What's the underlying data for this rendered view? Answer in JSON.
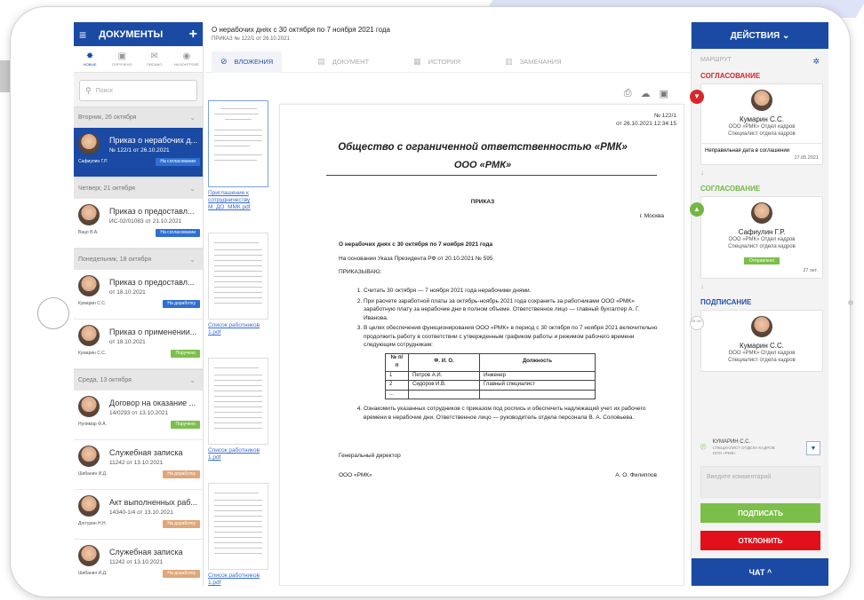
{
  "left": {
    "title": "ДОКУМЕНТЫ",
    "menu_icon": "hamburger-icon",
    "add": "+",
    "tabs": [
      {
        "label": "НОВЫЕ",
        "icon": "sun-icon"
      },
      {
        "label": "ПОРУЧЕНО",
        "icon": "folder-icon"
      },
      {
        "label": "ПИСЬМО",
        "icon": "mail-icon"
      },
      {
        "label": "НА КОНТРОЛЕ",
        "icon": "eye-icon"
      }
    ],
    "search_placeholder": "Поиск",
    "groups": [
      {
        "label": "Вторник, 26 октября",
        "items": [
          {
            "title": "Приказ о нерабочих д...",
            "sub": "№ 122/1 от 26.10.2021",
            "author": "Сафиулин Г.Р.",
            "badge": "На согласовании",
            "badge_color": "blue",
            "selected": true
          }
        ]
      },
      {
        "label": "Четверг, 21 октября",
        "items": [
          {
            "title": "Приказ о предоставл...",
            "sub": "ИС-02/01083 от 21.10.2021",
            "author": "Вацо В.А.",
            "badge": "На согласовании",
            "badge_color": "blue"
          }
        ]
      },
      {
        "label": "Понедельник, 18 октября",
        "items": [
          {
            "title": "Приказ о предоставл...",
            "sub": "от 18.10.2021",
            "author": "Кумарин С.С.",
            "badge": "На доработку",
            "badge_color": "blue"
          },
          {
            "title": "Приказ о применении...",
            "sub": "от 18.10.2021",
            "author": "Кумарин С.С.",
            "badge": "Поручено",
            "badge_color": "green"
          }
        ]
      },
      {
        "label": "Среда, 13 октября",
        "items": [
          {
            "title": "Договор на оказание ...",
            "sub": "14/0293 от 13.10.2021",
            "author": "Нулимар Ф.А.",
            "badge": "Поручено",
            "badge_color": "green"
          },
          {
            "title": "Служебная записка",
            "sub": "11242 от 13.10.2021",
            "author": "Шибанин И.Д.",
            "badge": "На доработку",
            "badge_color": "orange"
          },
          {
            "title": "Акт выполненных раб...",
            "sub": "14340-1/4 от 13.10.2021",
            "author": "Доггурин Н.Н.",
            "badge": "На доработку",
            "badge_color": "orange"
          },
          {
            "title": "Служебная записка",
            "sub": "11242 от 13.10.2021",
            "author": "Шибанин И.Д.",
            "badge": "На доработку",
            "badge_color": "orange"
          }
        ]
      }
    ]
  },
  "doc_header": {
    "title": "О нерабочих днях с 30 октября по 7 ноября 2021 года",
    "subtitle": "ПРИКАЗ   № 122/1 от 26.10.2021"
  },
  "tabs": [
    {
      "label": "ВЛОЖЕНИЯ",
      "icon": "paperclip-icon",
      "active": true
    },
    {
      "label": "ДОКУМЕНТ",
      "icon": "document-icon"
    },
    {
      "label": "ИСТОРИЯ",
      "icon": "calendar-icon"
    },
    {
      "label": "ЗАМЕЧАНИЯ",
      "icon": "notes-icon"
    }
  ],
  "attachments": [
    {
      "label": "Приглашение к сотрудничеству М_ДО_ММК.pdf"
    },
    {
      "label": "Список работников 1.pdf"
    },
    {
      "label": "Список работников 1.pdf"
    },
    {
      "label": "Список работников 1.pdf"
    }
  ],
  "doc_tools": [
    "print-icon",
    "cloud-download-icon",
    "image-icon"
  ],
  "document": {
    "num": "№ 122/1",
    "date": "от 26.10.2021 12:34:15",
    "org": "Общество с ограниченной ответственностью «РМК»",
    "org_short": "ООО «РМК»",
    "order": "ПРИКАЗ",
    "city": "г. Москва",
    "heading": "О нерабочих днях с 30 октября по 7 ноября 2021 года",
    "basis": "На основании Указа Президента РФ от 20.10.2021 № 595",
    "decree": "ПРИКАЗЫВАЮ:",
    "p1": "Считать 30 октября — 7 ноября 2021 года нерабочими днями.",
    "p2": "При расчете заработной платы за октябрь-ноябрь 2021 года сохранить за работниками ООО «РМК» заработную плату за нерабочие дни в полном объеме. Ответственное лицо — главный бухгалтер А. Г. Иванова.",
    "p3": "В целях обеспечения функционирования ООО «РМК» в период с 30 октября по 7 ноября 2021 включительно продолжить работу в соответствии с утвержденным графиком работы и режимом рабочего времени следующим сотрудникам:",
    "table_head": [
      "№ п/п",
      "Ф. И. О.",
      "Должность"
    ],
    "table_rows": [
      [
        "1",
        "Петров А.И.",
        "Инженер"
      ],
      [
        "2",
        "Сидоров И.В.",
        "Главный специалист"
      ],
      [
        "...",
        "",
        ""
      ]
    ],
    "p4": "Ознакомить указанных сотрудников с приказом под роспись и обеспечить надлежащий учет их рабочего времени в нерабочие дни. Ответственное лицо — руководитель отдела персонала В. А. Соловьева.",
    "sign_role": "Генеральный директор",
    "sign_org": "ООО «РМК»",
    "sign_name": "А. О. Филиппов"
  },
  "right": {
    "title": "ДЕЙСТВИЯ ⌄",
    "route_label": "МАРШРУТ",
    "steps": [
      {
        "section": "СОГЛАСОВАНИЕ",
        "color": "red",
        "name": "Кумарин С.С.",
        "dept": "ООО «РМК» Отдел кадров",
        "role": "Специалист отдела кадров",
        "comment": "Неправильная дата в соглашении",
        "comment_date": "17.05.2021"
      },
      {
        "section": "СОГЛАСОВАНИЕ",
        "color": "green",
        "name": "Сафиулин Г.Р.",
        "dept": "ООО «РМК» Отдел кадров",
        "role": "Специалист отдела кадров",
        "status": "Отправлено",
        "date": "27 окт."
      },
      {
        "section": "ПОДПИСАНИЕ",
        "color": "blue",
        "name": "Кумарин С.С.",
        "dept": "ООО «РМК» Отдел кадров",
        "role": "Специалист отдела кадров",
        "date_mark": "26 окт."
      }
    ],
    "signer_name": "КУМАРИН С.С.",
    "signer_role": "СПЕЦИАЛИСТ ОТДЕЛА КАДРОВ",
    "signer_org": "ООО «РМК»",
    "comment_placeholder": "Введите комментарий",
    "sign_button": "ПОДПИСАТЬ",
    "reject_button": "ОТКЛОНИТЬ",
    "chat": "ЧАТ ^"
  }
}
